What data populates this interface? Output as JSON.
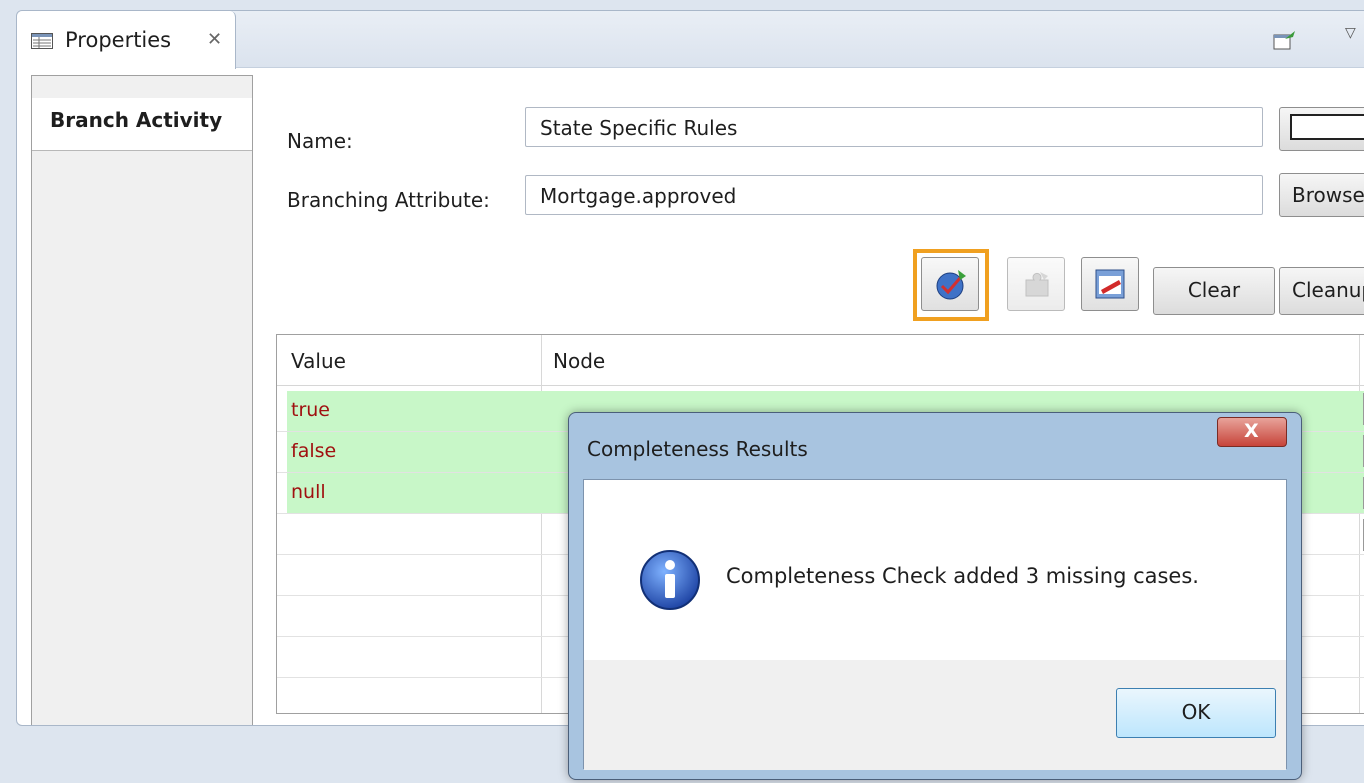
{
  "panel": {
    "tab_label": "Properties",
    "tab_close": "✕"
  },
  "sidebar": {
    "active_item": "Branch Activity"
  },
  "form": {
    "name_label": "Name:",
    "name_value": "State Specific Rules",
    "attribute_label": "Branching Attribute:",
    "attribute_value": "Mortgage.approved",
    "browse_label": "Browse",
    "clear_label": "Clear",
    "cleanup_label": "Cleanup"
  },
  "toolbar": {
    "completeness_icon": "completeness-check-icon",
    "disabled_icon": "puzzle-icon",
    "table_icon": "table-edit-icon",
    "highlight_color": "#f0a020"
  },
  "table": {
    "columns": [
      "Value",
      "Node"
    ],
    "rows": [
      {
        "value": "true"
      },
      {
        "value": "false"
      },
      {
        "value": "null"
      }
    ],
    "row_color": "#c8f7c8",
    "value_color": "#a01010"
  },
  "dialog": {
    "title": "Completeness Results",
    "close_glyph": "X",
    "message": "Completeness Check added 3 missing cases.",
    "ok_label": "OK",
    "icon": "info-icon"
  }
}
